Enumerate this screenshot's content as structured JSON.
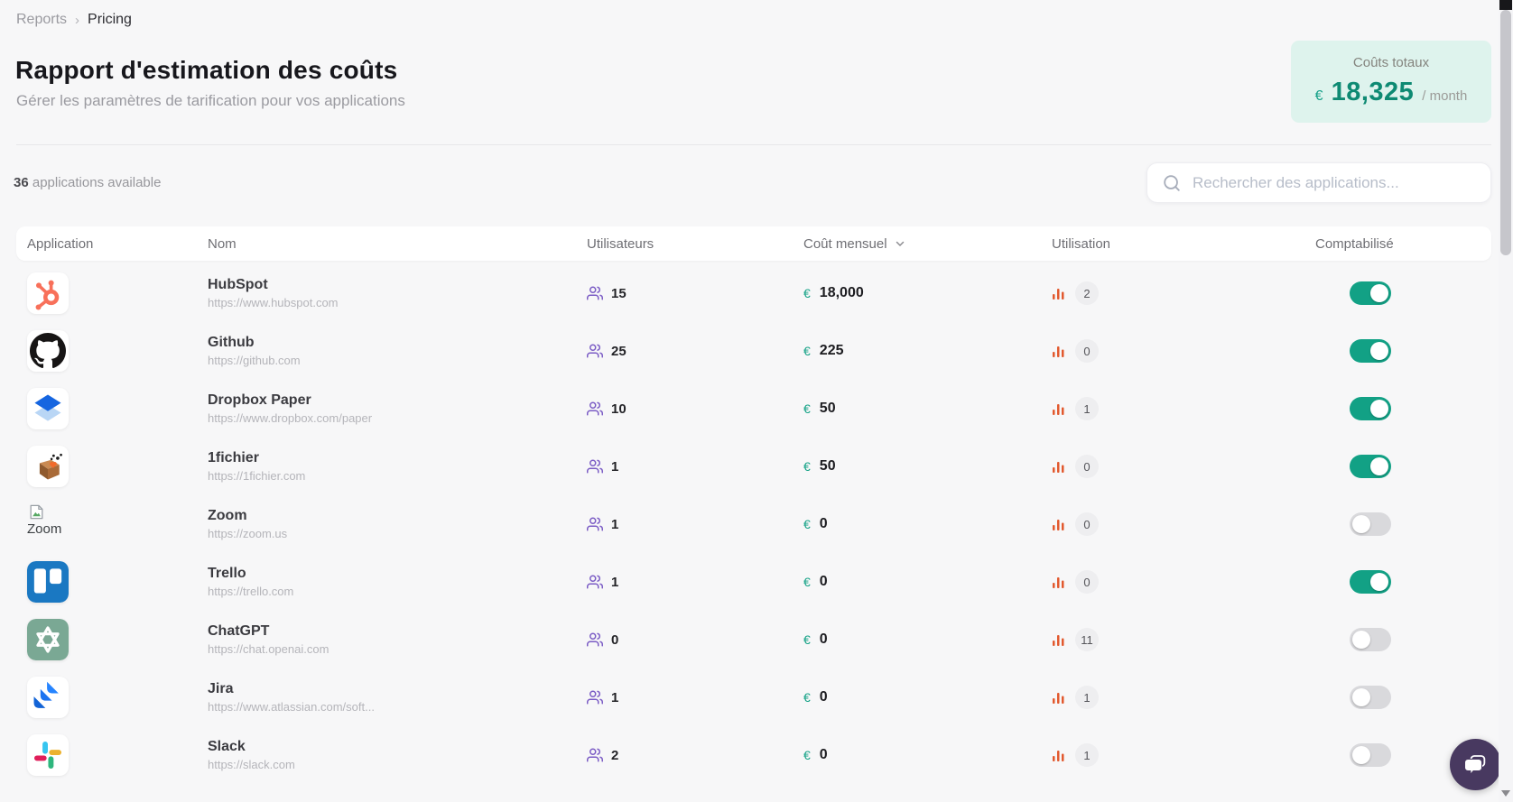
{
  "breadcrumb": {
    "parent": "Reports",
    "separator": "›",
    "current": "Pricing"
  },
  "header": {
    "title": "Rapport d'estimation des coûts",
    "subtitle": "Gérer les paramètres de tarification pour vos applications"
  },
  "total_cost_card": {
    "label": "Coûts totaux",
    "currency": "€",
    "amount": "18,325",
    "period": "/ month"
  },
  "toolbar": {
    "count": "36",
    "count_suffix": " applications available",
    "search_placeholder": "Rechercher des applications..."
  },
  "table": {
    "columns": {
      "application": "Application",
      "name": "Nom",
      "users": "Utilisateurs",
      "monthly_cost": "Coût mensuel",
      "usage": "Utilisation",
      "accounted": "Comptabilisé"
    },
    "sorted_column": "Coût mensuel",
    "currency_symbol": "€",
    "rows": [
      {
        "name": "HubSpot",
        "url": "https://www.hubspot.com",
        "users": "15",
        "cost": "18,000",
        "usage": "2",
        "enabled": true,
        "icon": "hubspot"
      },
      {
        "name": "Github",
        "url": "https://github.com",
        "users": "25",
        "cost": "225",
        "usage": "0",
        "enabled": true,
        "icon": "github"
      },
      {
        "name": "Dropbox Paper",
        "url": "https://www.dropbox.com/paper",
        "users": "10",
        "cost": "50",
        "usage": "1",
        "enabled": true,
        "icon": "dropbox-paper"
      },
      {
        "name": "1fichier",
        "url": "https://1fichier.com",
        "users": "1",
        "cost": "50",
        "usage": "0",
        "enabled": true,
        "icon": "1fichier"
      },
      {
        "name": "Zoom",
        "url": "https://zoom.us",
        "users": "1",
        "cost": "0",
        "usage": "0",
        "enabled": false,
        "icon": "broken-image",
        "alt_text": "Zoom"
      },
      {
        "name": "Trello",
        "url": "https://trello.com",
        "users": "1",
        "cost": "0",
        "usage": "0",
        "enabled": true,
        "icon": "trello"
      },
      {
        "name": "ChatGPT",
        "url": "https://chat.openai.com",
        "users": "0",
        "cost": "0",
        "usage": "11",
        "enabled": false,
        "icon": "chatgpt"
      },
      {
        "name": "Jira",
        "url": "https://www.atlassian.com/soft...",
        "users": "1",
        "cost": "0",
        "usage": "1",
        "enabled": false,
        "icon": "jira"
      },
      {
        "name": "Slack",
        "url": "https://slack.com",
        "users": "2",
        "cost": "0",
        "usage": "1",
        "enabled": false,
        "icon": "slack"
      }
    ]
  },
  "colors": {
    "accent_teal": "#12a185",
    "amount_teal": "#0e8a73",
    "card_mint": "#def3ed",
    "users_purple": "#7b5cc5",
    "usage_orange": "#e2592e",
    "toggle_off": "#d9d9dc",
    "chat_purple": "#483960",
    "page_bg": "#f7f7f8"
  }
}
